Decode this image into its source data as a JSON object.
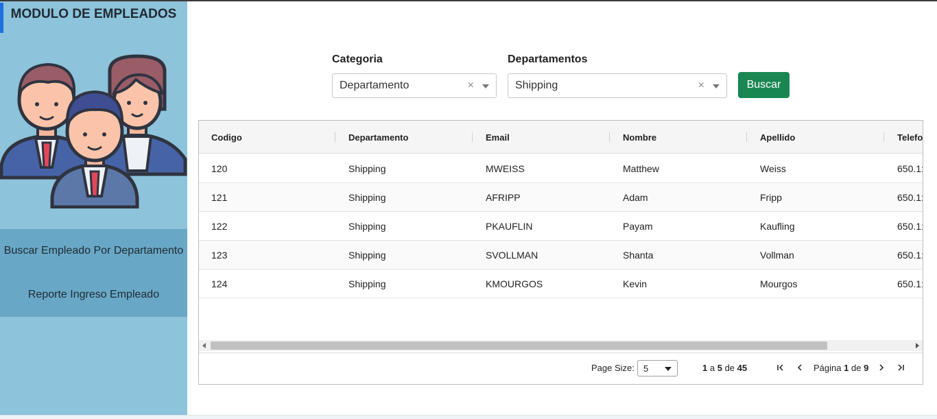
{
  "sidebar": {
    "title": "MODULO DE EMPLEADOS",
    "menu": [
      {
        "label": "Buscar Empleado Por Departamento"
      },
      {
        "label": "Reporte Ingreso Empleado"
      }
    ]
  },
  "filters": {
    "categoria_label": "Categoria",
    "categoria_value": "Departamento",
    "departamentos_label": "Departamentos",
    "departamentos_value": "Shipping",
    "clear_symbol": "×",
    "search_button": "Buscar"
  },
  "grid": {
    "columns": [
      "Codigo",
      "Departamento",
      "Email",
      "Nombre",
      "Apellido",
      "Telefo"
    ],
    "rows": [
      [
        "120",
        "Shipping",
        "MWEISS",
        "Matthew",
        "Weiss",
        "650.1:"
      ],
      [
        "121",
        "Shipping",
        "AFRIPP",
        "Adam",
        "Fripp",
        "650.1:"
      ],
      [
        "122",
        "Shipping",
        "PKAUFLIN",
        "Payam",
        "Kaufling",
        "650.1:"
      ],
      [
        "123",
        "Shipping",
        "SVOLLMAN",
        "Shanta",
        "Vollman",
        "650.1:"
      ],
      [
        "124",
        "Shipping",
        "KMOURGOS",
        "Kevin",
        "Mourgos",
        "650.1:"
      ]
    ]
  },
  "pager": {
    "page_size_label": "Page Size:",
    "page_size": "5",
    "from": "1",
    "a": "a",
    "to": "5",
    "de": "de",
    "total": "45",
    "pagina_label": "Página",
    "page": "1",
    "page_de": "de",
    "page_count": "9"
  },
  "colors": {
    "sidebar_bg": "#8dc3db",
    "menu_bg": "#69a7c6",
    "accent": "#1e6fe0",
    "button_bg": "#1a8753"
  }
}
